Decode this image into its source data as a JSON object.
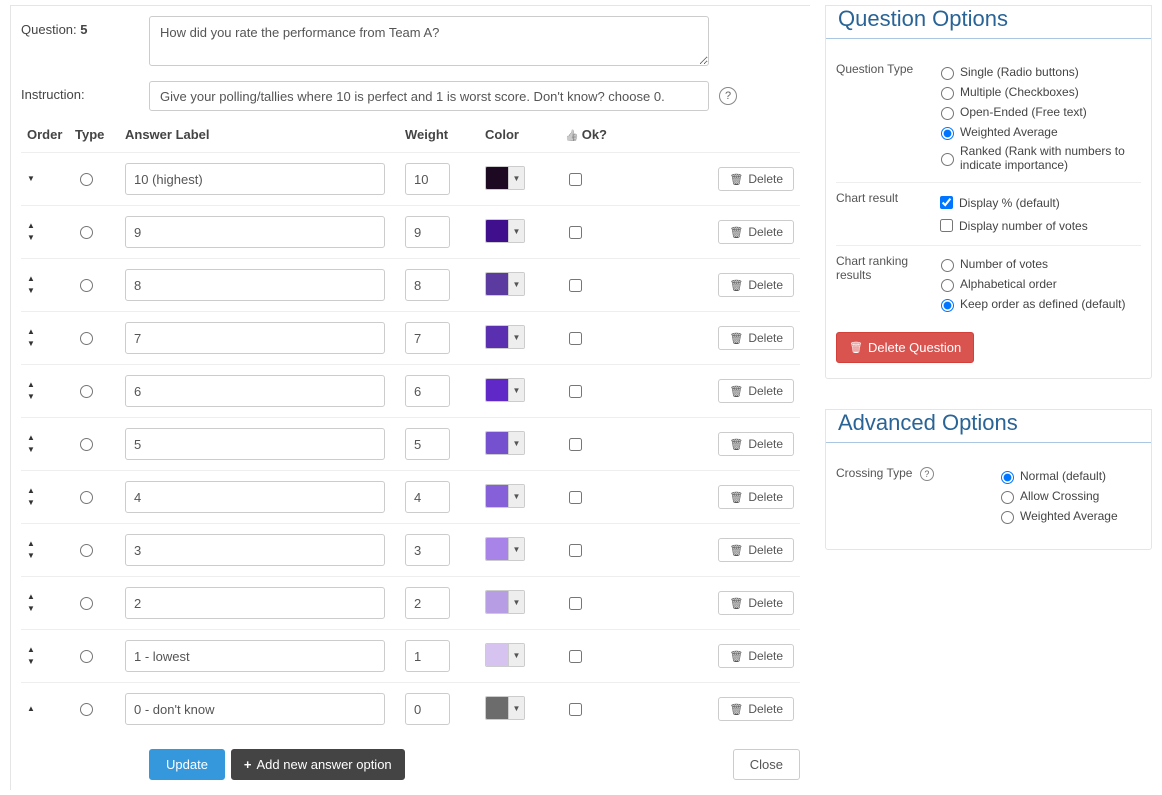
{
  "questionNumberLabel": "Question:",
  "questionNumber": "5",
  "instructionLabel": "Instruction:",
  "questionText": "How did you rate the performance from Team A?",
  "instructionText": "Give your polling/tallies where 10 is perfect and 1 is worst score. Don't know? choose 0.",
  "headers": {
    "order": "Order",
    "type": "Type",
    "label": "Answer Label",
    "weight": "Weight",
    "color": "Color",
    "ok": "Ok?"
  },
  "answers": [
    {
      "label": "10 (highest)",
      "weight": "10",
      "color": "#1d0a22",
      "up": false,
      "down": true
    },
    {
      "label": "9",
      "weight": "9",
      "color": "#3f0f8e",
      "up": true,
      "down": true
    },
    {
      "label": "8",
      "weight": "8",
      "color": "#5c3ba0",
      "up": true,
      "down": true
    },
    {
      "label": "7",
      "weight": "7",
      "color": "#5a2fb0",
      "up": true,
      "down": true
    },
    {
      "label": "6",
      "weight": "6",
      "color": "#5f28c7",
      "up": true,
      "down": true
    },
    {
      "label": "5",
      "weight": "5",
      "color": "#7551cf",
      "up": true,
      "down": true
    },
    {
      "label": "4",
      "weight": "4",
      "color": "#8560d8",
      "up": true,
      "down": true
    },
    {
      "label": "3",
      "weight": "3",
      "color": "#a884e8",
      "up": true,
      "down": true
    },
    {
      "label": "2",
      "weight": "2",
      "color": "#b69de4",
      "up": true,
      "down": true
    },
    {
      "label": "1 - lowest",
      "weight": "1",
      "color": "#d6c3f0",
      "up": true,
      "down": true
    },
    {
      "label": "0 - don't know",
      "weight": "0",
      "color": "#6c6c6c",
      "up": true,
      "down": false
    }
  ],
  "buttons": {
    "delete": "Delete",
    "update": "Update",
    "addOption": "Add new answer option",
    "close": "Close",
    "deleteQuestion": "Delete Question"
  },
  "sidebar": {
    "questionOptionsTitle": "Question Options",
    "advancedOptionsTitle": "Advanced Options",
    "questionType": {
      "label": "Question Type",
      "options": [
        "Single (Radio buttons)",
        "Multiple (Checkboxes)",
        "Open-Ended (Free text)",
        "Weighted Average",
        "Ranked (Rank with numbers to indicate importance)"
      ],
      "selected": 3
    },
    "chartResult": {
      "label": "Chart result",
      "options": [
        "Display % (default)",
        "Display number of votes"
      ],
      "checked": [
        true,
        false
      ]
    },
    "chartRanking": {
      "label": "Chart ranking results",
      "options": [
        "Number of votes",
        "Alphabetical order",
        "Keep order as defined (default)"
      ],
      "selected": 2
    },
    "crossingType": {
      "label": "Crossing Type",
      "options": [
        "Normal (default)",
        "Allow Crossing",
        "Weighted Average"
      ],
      "selected": 0
    }
  }
}
